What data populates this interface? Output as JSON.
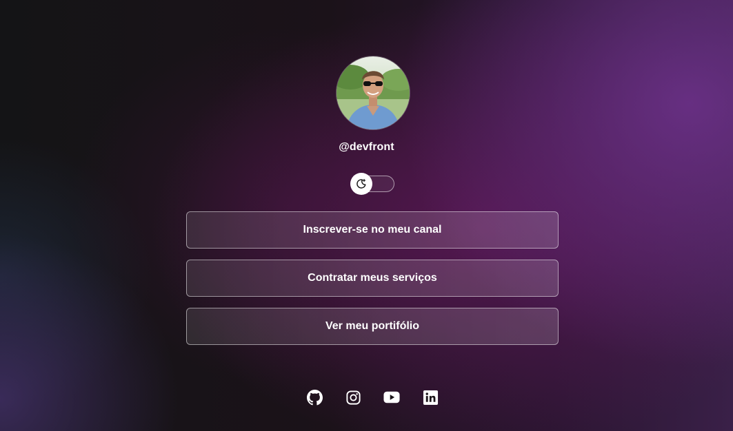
{
  "profile": {
    "avatar_alt": "profile-photo",
    "username": "@devfront"
  },
  "theme_toggle": {
    "icon": "moon-icon",
    "state": "dark"
  },
  "links": [
    {
      "label": "Inscrever-se no meu canal"
    },
    {
      "label": "Contratar meus serviços"
    },
    {
      "label": "Ver meu portifólio"
    }
  ],
  "socials": [
    {
      "icon": "github-icon"
    },
    {
      "icon": "instagram-icon"
    },
    {
      "icon": "youtube-icon"
    },
    {
      "icon": "linkedin-icon"
    }
  ],
  "colors": {
    "text": "#ffffff",
    "accent_purple": "#6e328c",
    "accent_magenta": "#64195f",
    "background": "#151318"
  }
}
